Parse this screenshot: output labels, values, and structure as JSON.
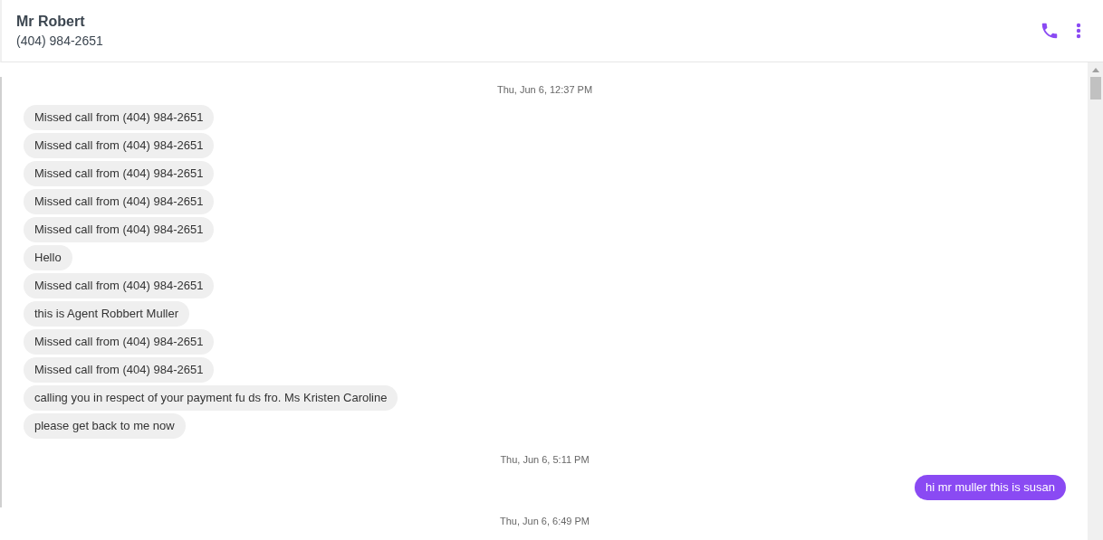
{
  "contact": {
    "name": "Mr Robert",
    "phone": "(404) 984-2651"
  },
  "thread": [
    {
      "kind": "time",
      "text": "Thu, Jun 6, 12:37 PM"
    },
    {
      "kind": "in",
      "text": "Missed call from (404) 984-2651"
    },
    {
      "kind": "in",
      "text": "Missed call from (404) 984-2651"
    },
    {
      "kind": "in",
      "text": "Missed call from (404) 984-2651"
    },
    {
      "kind": "in",
      "text": "Missed call from (404) 984-2651"
    },
    {
      "kind": "in",
      "text": "Missed call from (404) 984-2651"
    },
    {
      "kind": "in",
      "text": "Hello"
    },
    {
      "kind": "in",
      "text": "Missed call from (404) 984-2651"
    },
    {
      "kind": "in",
      "text": "this is Agent Robbert Muller"
    },
    {
      "kind": "in",
      "text": "Missed call from (404) 984-2651"
    },
    {
      "kind": "in",
      "text": "Missed call from (404) 984-2651"
    },
    {
      "kind": "in",
      "text": "calling you in respect of your payment fu ds fro. Ms Kristen Caroline"
    },
    {
      "kind": "in",
      "text": "please get back to me now"
    },
    {
      "kind": "time",
      "text": "Thu, Jun 6, 5:11 PM"
    },
    {
      "kind": "out",
      "text": "hi mr muller this is susan"
    },
    {
      "kind": "time",
      "text": "Thu, Jun 6, 6:49 PM"
    }
  ]
}
